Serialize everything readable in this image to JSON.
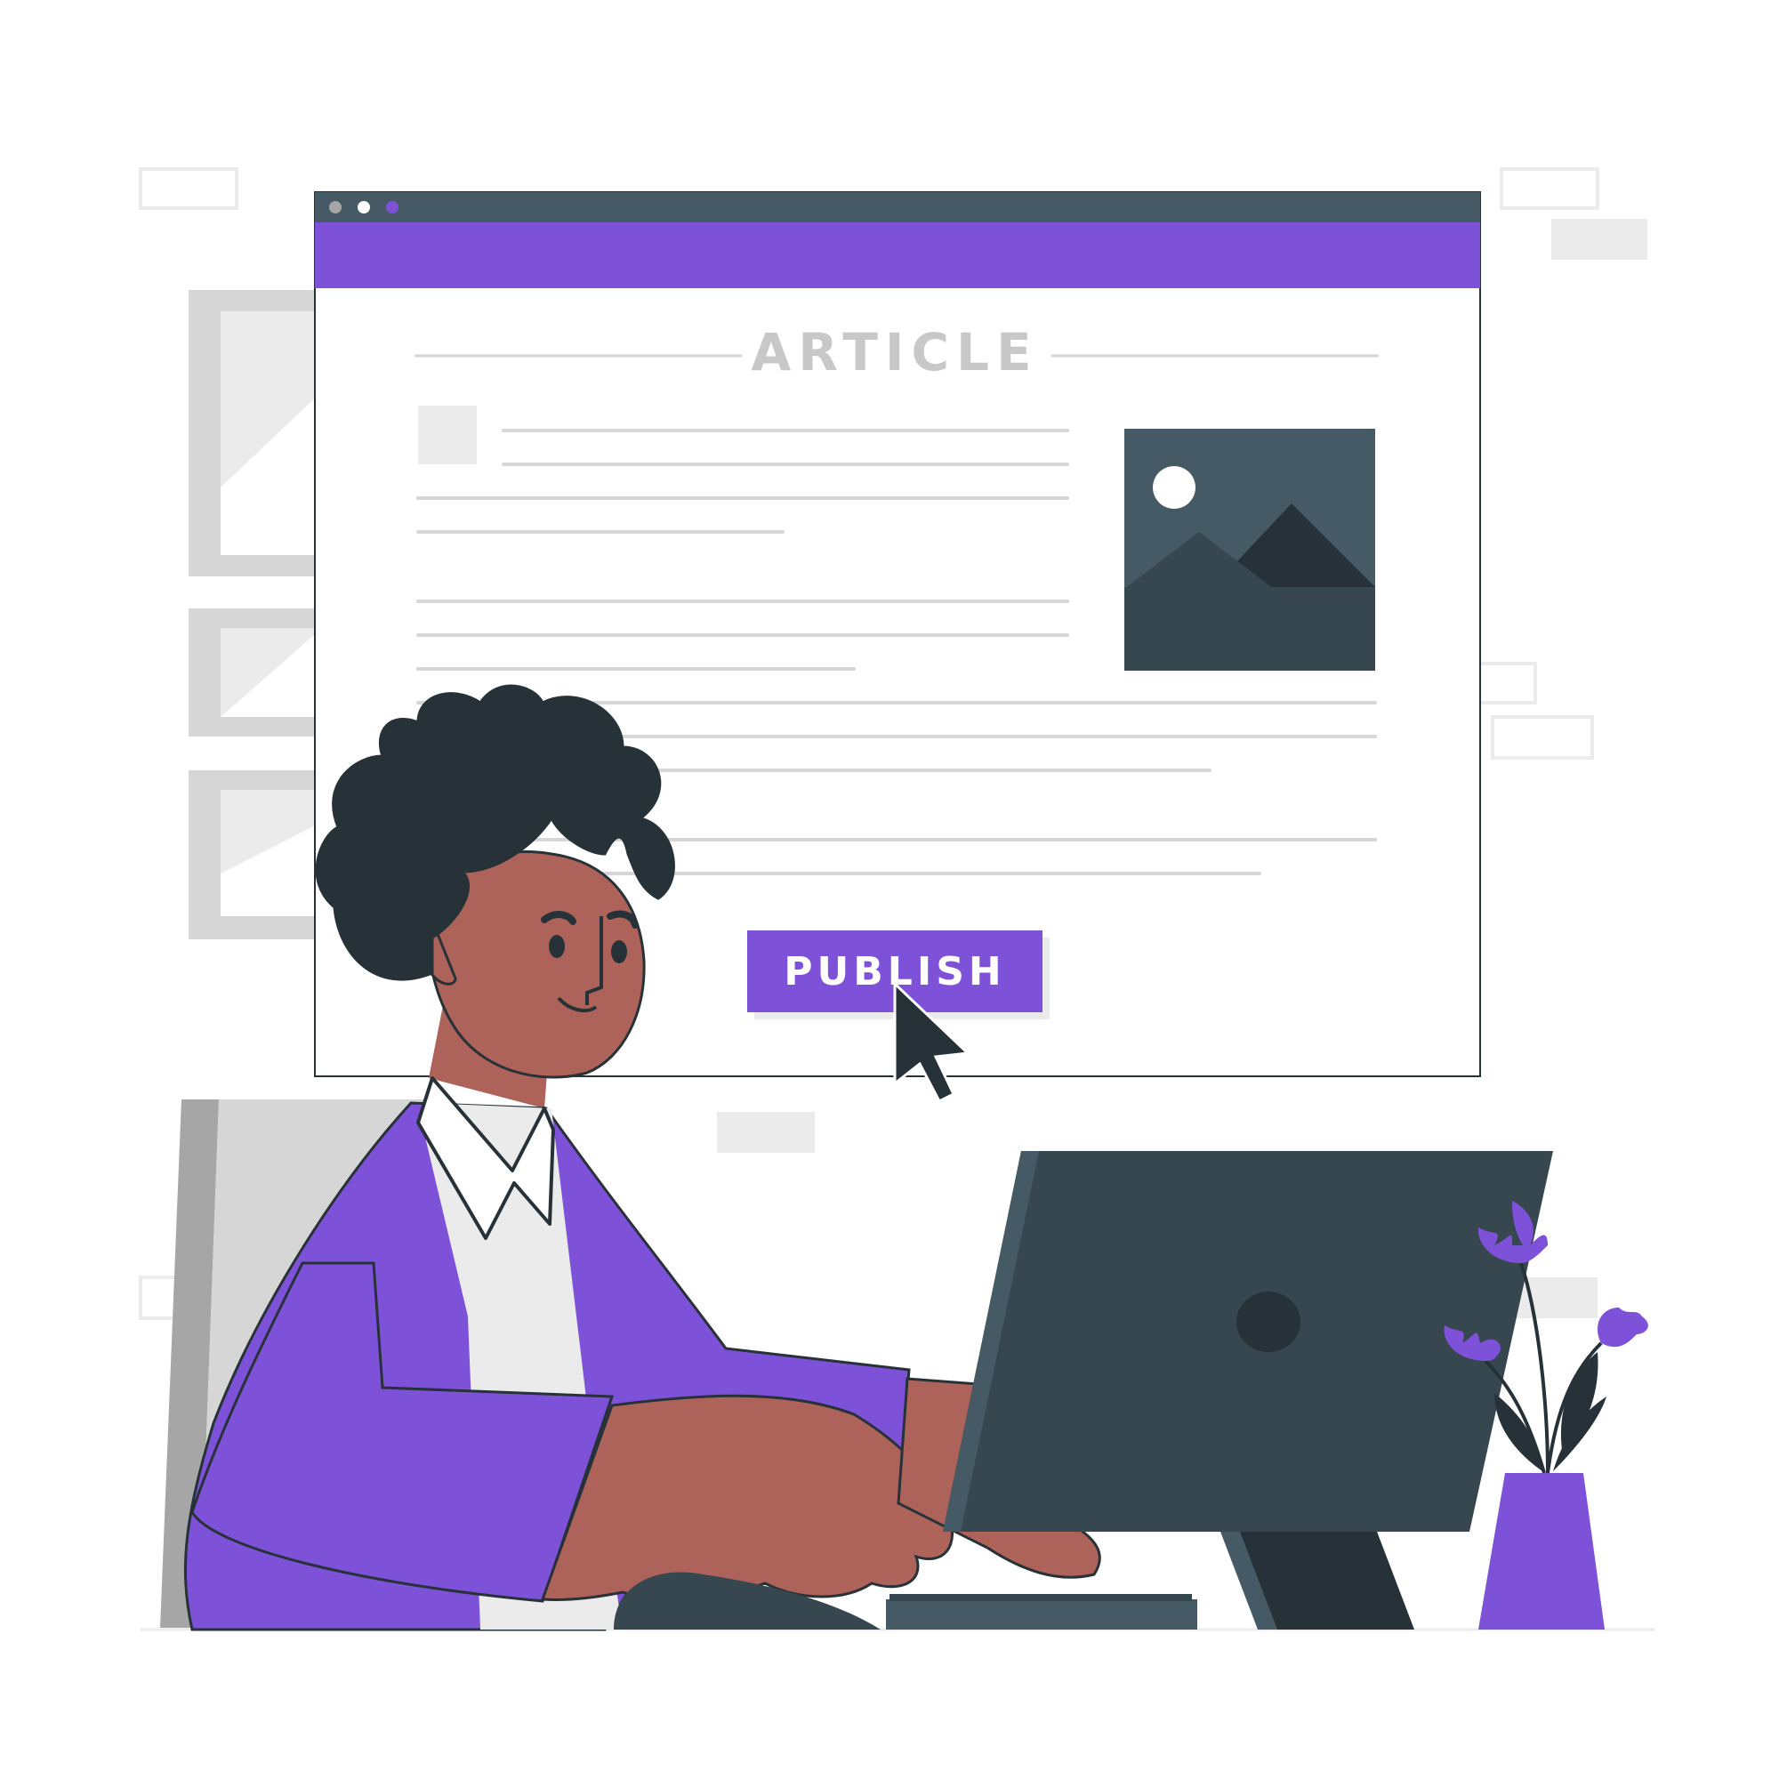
{
  "article": {
    "heading": "ARTICLE",
    "publish_label": "PUBLISH"
  },
  "colors": {
    "accent": "#7e51d9",
    "browser_bar": "#455a64",
    "dark": "#263238",
    "skin": "#ad6359",
    "light_gray": "#ebebeb"
  },
  "icons": {
    "browser_dots": [
      "dot-icon",
      "dot-icon",
      "dot-icon"
    ],
    "image_placeholder": "image-icon",
    "cursor": "cursor-arrow-icon"
  }
}
